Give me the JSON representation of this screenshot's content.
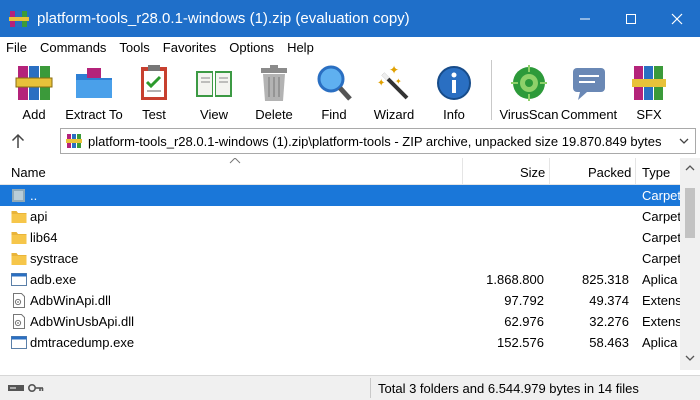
{
  "window": {
    "title": "platform-tools_r28.0.1-windows (1).zip (evaluation copy)",
    "title_bar_color": "#1f6fc9",
    "buttons": [
      "minimize-icon",
      "maximize-icon",
      "close-icon"
    ]
  },
  "menu": [
    "File",
    "Commands",
    "Tools",
    "Favorites",
    "Options",
    "Help"
  ],
  "toolbar": [
    {
      "label": "Add",
      "icon": "winrar-books-icon"
    },
    {
      "label": "Extract To",
      "icon": "folder-extract-icon"
    },
    {
      "label": "Test",
      "icon": "clipboard-check-icon"
    },
    {
      "label": "View",
      "icon": "open-book-icon"
    },
    {
      "label": "Delete",
      "icon": "trash-can-icon"
    },
    {
      "label": "Find",
      "icon": "magnifier-icon"
    },
    {
      "label": "Wizard",
      "icon": "magic-wand-icon"
    },
    {
      "label": "Info",
      "icon": "info-icon"
    },
    {
      "label": "VirusScan",
      "icon": "virus-scan-icon"
    },
    {
      "label": "Comment",
      "icon": "comment-icon"
    },
    {
      "label": "SFX",
      "icon": "sfx-icon"
    }
  ],
  "address": {
    "path": "platform-tools_r28.0.1-windows (1).zip\\platform-tools - ZIP archive, unpacked size 19.870.849 bytes"
  },
  "columns": {
    "name": "Name",
    "size": "Size",
    "packed": "Packed",
    "type": "Type"
  },
  "files": [
    {
      "name": "..",
      "size": "",
      "packed": "",
      "type": "Carpet",
      "icon": "parent-folder-icon",
      "selected": true
    },
    {
      "name": "api",
      "size": "",
      "packed": "",
      "type": "Carpet",
      "icon": "folder-icon"
    },
    {
      "name": "lib64",
      "size": "",
      "packed": "",
      "type": "Carpet",
      "icon": "folder-icon"
    },
    {
      "name": "systrace",
      "size": "",
      "packed": "",
      "type": "Carpet",
      "icon": "folder-icon"
    },
    {
      "name": "adb.exe",
      "size": "1.868.800",
      "packed": "825.318",
      "type": "Aplica",
      "icon": "exe-icon"
    },
    {
      "name": "AdbWinApi.dll",
      "size": "97.792",
      "packed": "49.374",
      "type": "Extens",
      "icon": "dll-icon"
    },
    {
      "name": "AdbWinUsbApi.dll",
      "size": "62.976",
      "packed": "32.276",
      "type": "Extens",
      "icon": "dll-icon"
    },
    {
      "name": "dmtracedump.exe",
      "size": "152.576",
      "packed": "58.463",
      "type": "Aplica",
      "icon": "exe-icon"
    }
  ],
  "status": {
    "text": "Total 3 folders and 6.544.979 bytes in 14 files"
  },
  "colors": {
    "selection": "#1a77d9",
    "folder": "#f6c64a"
  }
}
